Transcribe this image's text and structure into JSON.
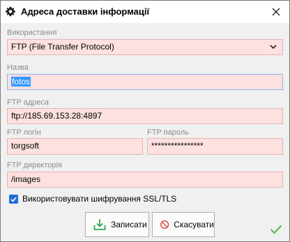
{
  "window": {
    "title": "Адреса доставки інформації"
  },
  "form": {
    "usage_label": "Використання",
    "usage_value": "FTP (File Transfer Protocol)",
    "name_label": "Назва",
    "name_value": "fotos",
    "ftp_address_label": "FTP адреса",
    "ftp_address_value": "ftp://185.69.153.28:4897",
    "ftp_login_label": "FTP логін",
    "ftp_login_value": "torgsoft",
    "ftp_password_label": "FTP пароль",
    "ftp_password_value": "****************",
    "ftp_directory_label": "FTP директорія",
    "ftp_directory_value": "/images",
    "ssl_label": "Використовувати шифрування SSL/TLS",
    "ssl_checked": true
  },
  "buttons": {
    "save_label": "Записати",
    "cancel_label": "Скасувати"
  },
  "icons": {
    "title": "gear-icon",
    "close": "close-icon",
    "usage_dropdown": "chevron-down-icon",
    "save": "download-icon",
    "cancel": "no-entry-icon",
    "status": "checkmark-icon"
  },
  "colors": {
    "required_field_bg": "#fde0e0",
    "selection": "#3399ff",
    "checkbox": "#1e6fd9",
    "save_icon": "#2fa84f",
    "cancel_icon": "#d9342b",
    "ok_mark": "#5cb85c"
  }
}
